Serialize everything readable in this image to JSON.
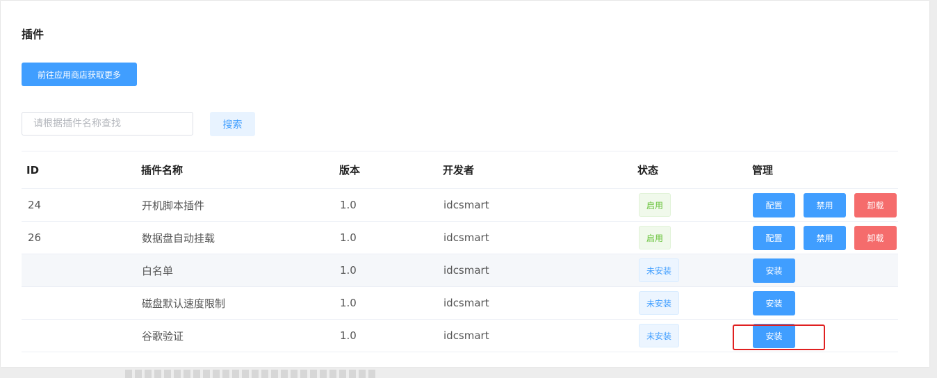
{
  "page": {
    "title": "插件",
    "store_button": "前往应用商店获取更多",
    "search_placeholder": "请根据插件名称查找",
    "search_button": "搜索"
  },
  "table": {
    "headers": {
      "id": "ID",
      "name": "插件名称",
      "version": "版本",
      "developer": "开发者",
      "status": "状态",
      "manage": "管理"
    },
    "rows": [
      {
        "id": "24",
        "name": "开机脚本插件",
        "version": "1.0",
        "developer": "idcsmart",
        "status": "启用",
        "actions": [
          "配置",
          "禁用",
          "卸载"
        ]
      },
      {
        "id": "26",
        "name": "数据盘自动挂载",
        "version": "1.0",
        "developer": "idcsmart",
        "status": "启用",
        "actions": [
          "配置",
          "禁用",
          "卸载"
        ]
      },
      {
        "id": "",
        "name": "白名单",
        "version": "1.0",
        "developer": "idcsmart",
        "status": "未安装",
        "actions": [
          "安装"
        ]
      },
      {
        "id": "",
        "name": "磁盘默认速度限制",
        "version": "1.0",
        "developer": "idcsmart",
        "status": "未安装",
        "actions": [
          "安装"
        ]
      },
      {
        "id": "",
        "name": "谷歌验证",
        "version": "1.0",
        "developer": "idcsmart",
        "status": "未安装",
        "actions": [
          "安装"
        ]
      }
    ]
  },
  "colors": {
    "primary": "#409eff",
    "danger": "#f56c6c",
    "success": "#67c23a",
    "highlight": "#e02020"
  }
}
